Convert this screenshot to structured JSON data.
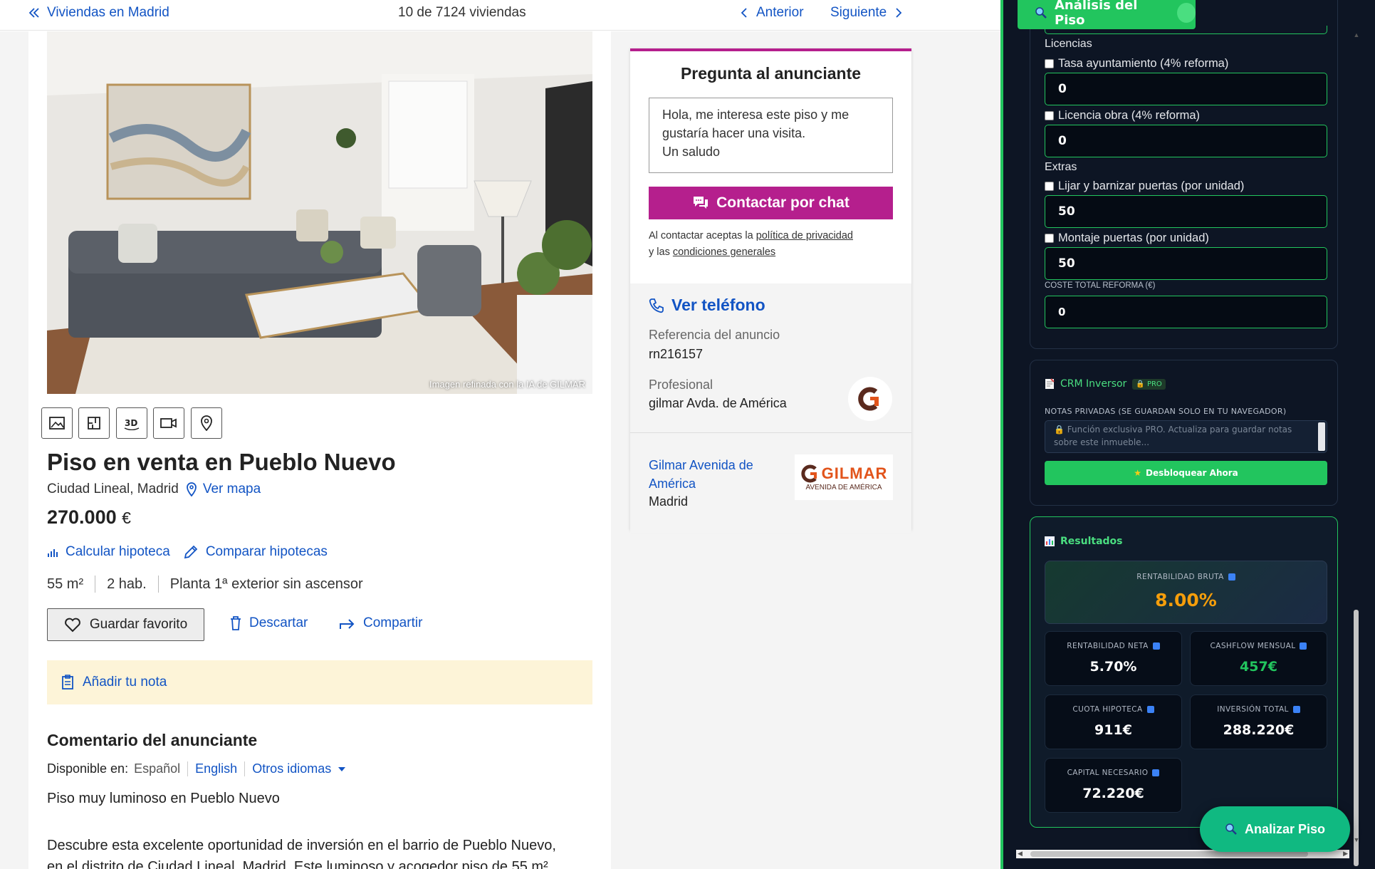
{
  "topbar": {
    "back_label": "Viviendas en Madrid",
    "counter": "10 de 7124 viviendas",
    "prev_label": "Anterior",
    "next_label": "Siguiente"
  },
  "photo": {
    "credit": "Imagen refinada con la IA de GILMAR"
  },
  "media_buttons": [
    "image-icon",
    "floorplan-icon",
    "3d-icon",
    "video-icon",
    "map-pin-icon"
  ],
  "listing": {
    "title": "Piso en venta en Pueblo Nuevo",
    "location": "Ciudad Lineal, Madrid",
    "map_label": "Ver mapa",
    "price": "270.000",
    "currency": "€",
    "calc_mortgage": "Calcular hipoteca",
    "compare_mortgage": "Comparar hipotecas",
    "features": [
      "55 m²",
      "2 hab.",
      "Planta 1ª exterior sin ascensor"
    ],
    "fav_label": "Guardar favorito",
    "discard_label": "Descartar",
    "share_label": "Compartir",
    "note_label": "Añadir tu nota",
    "comment_title": "Comentario del anunciante",
    "available_in": "Disponible en:",
    "lang_es": "Español",
    "lang_en": "English",
    "lang_other": "Otros idiomas",
    "desc_1": "Piso muy luminoso en Pueblo Nuevo",
    "desc_2": "Descubre esta excelente oportunidad de inversión en el barrio de Pueblo Nuevo,",
    "desc_3": "en el distrito de Ciudad Lineal, Madrid. Este luminoso y acogedor piso de 55 m²"
  },
  "contact": {
    "title": "Pregunta al anunciante",
    "message": "Hola, me interesa este piso y me\ngustaría hacer una visita.\nUn saludo",
    "chat_button": "Contactar por chat",
    "legal_1": "Al contactar aceptas la ",
    "privacy_link": "política de privacidad",
    "legal_2": "y las ",
    "terms_link": "condiciones generales",
    "phone_label": "Ver teléfono",
    "ref_label": "Referencia del anuncio",
    "ref_value": "rn216157",
    "pro_label": "Profesional",
    "pro_value": "gilmar Avda. de América",
    "agency_name": "Gilmar Avenida de América",
    "agency_city": "Madrid",
    "logo_main": "GILMAR",
    "logo_sub": "AVENIDA DE AMÉRICA"
  },
  "panel": {
    "tab_title": "Análisis del Piso",
    "licencias": "Licencias",
    "tasa_label": "Tasa ayuntamiento (4% reforma)",
    "tasa_value": "0",
    "licencia_label": "Licencia obra (4% reforma)",
    "licencia_value": "0",
    "extras": "Extras",
    "lijar_label": "Lijar y barnizar puertas (por unidad)",
    "lijar_value": "50",
    "montaje_label": "Montaje puertas (por unidad)",
    "montaje_value": "50",
    "coste_label": "COSTE TOTAL REFORMA (€)",
    "coste_value": "0",
    "crm_title": "CRM Inversor",
    "crm_badge": "PRO",
    "notes_label": "NOTAS PRIVADAS (SE GUARDAN SOLO EN TU NAVEGADOR)",
    "notes_placeholder": "Función exclusiva PRO. Actualiza para guardar notas sobre este inmueble...",
    "unlock_label": "Desbloquear Ahora",
    "results_title": "Resultados",
    "rent_bruta_label": "RENTABILIDAD BRUTA",
    "rent_bruta_value": "8.00%",
    "metrics": [
      {
        "label": "RENTABILIDAD NETA",
        "value": "5.70%",
        "color": "#ffffff"
      },
      {
        "label": "CASHFLOW MENSUAL",
        "value": "457€",
        "color": "#22c55e"
      },
      {
        "label": "CUOTA HIPOTECA",
        "value": "911€",
        "color": "#ffffff"
      },
      {
        "label": "INVERSIÓN TOTAL",
        "value": "288.220€",
        "color": "#ffffff"
      },
      {
        "label": "CAPITAL NECESARIO",
        "value": "72.220€",
        "color": "#ffffff"
      }
    ],
    "analyze_button": "Analizar Piso"
  },
  "colors": {
    "brand_blue": "#1254c4",
    "chat_magenta": "#b51f8d",
    "panel_green": "#22c55e",
    "panel_bg": "#0d1524",
    "accent_orange": "#f59e0b"
  }
}
